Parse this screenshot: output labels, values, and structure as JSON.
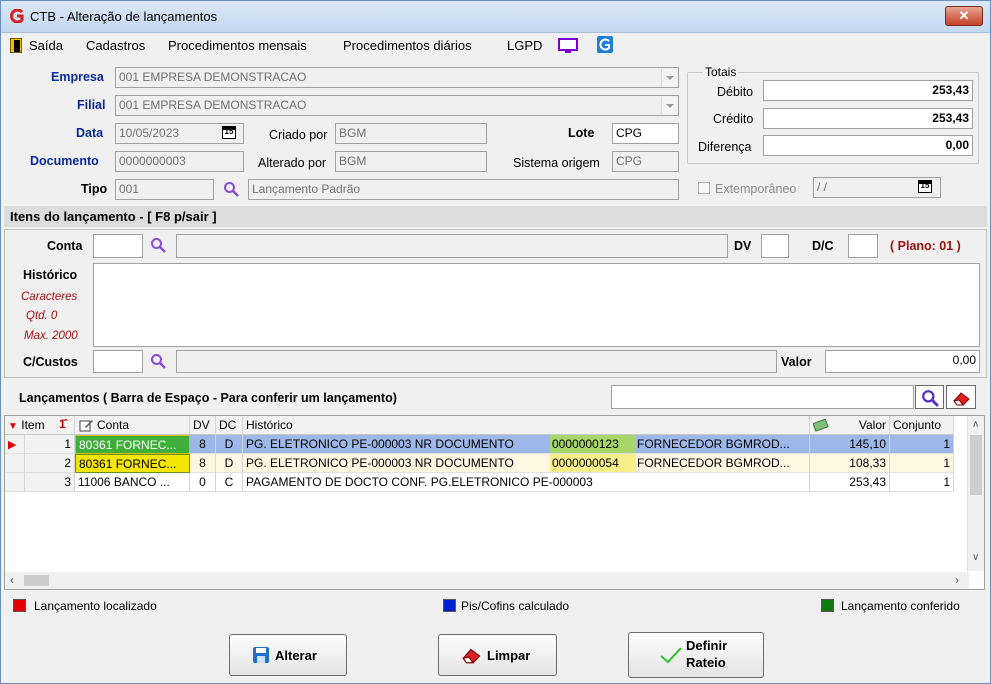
{
  "window": {
    "title": "CTB - Alteração de lançamentos",
    "close_glyph": "✕"
  },
  "menu": {
    "items": [
      "Saída",
      "Cadastros",
      "Procedimentos mensais",
      "Procedimentos diários",
      "LGPD"
    ]
  },
  "header": {
    "empresa_label": "Empresa",
    "empresa_value": "001 EMPRESA DEMONSTRACAO",
    "filial_label": "Filial",
    "filial_value": "001 EMPRESA DEMONSTRACAO",
    "data_label": "Data",
    "data_value": "10/05/2023",
    "criado_label": "Criado por",
    "criado_value": "BGM",
    "lote_label": "Lote",
    "lote_value": "CPG",
    "documento_label": "Documento",
    "documento_value": "0000000003",
    "alterado_label": "Alterado por",
    "alterado_value": "BGM",
    "sistema_label": "Sistema origem",
    "sistema_value": "CPG",
    "tipo_label": "Tipo",
    "tipo_value": "001",
    "tipo_desc": "Lançamento Padrão",
    "extemporaneo_label": "Extemporâneo",
    "extemporaneo_value": " / /"
  },
  "totais": {
    "title": "Totais",
    "debito_label": "Débito",
    "debito_value": "253,43",
    "credito_label": "Crédito",
    "credito_value": "253,43",
    "diferenca_label": "Diferença",
    "diferenca_value": "0,00"
  },
  "itens": {
    "title": "Itens do lançamento - [ F8 p/sair ]",
    "conta_label": "Conta",
    "dv_label": "DV",
    "dc_label": "D/C",
    "plano": "( Plano: 01 )",
    "historico_label": "Histórico",
    "caracteres": "Caracteres",
    "qtd": "Qtd. 0",
    "max": "Max. 2000",
    "custos_label": "C/Custos",
    "valor_label": "Valor",
    "valor_value": "0,00"
  },
  "lancamentos": {
    "title": "Lançamentos ( Barra de Espaço - Para conferir um lançamento)",
    "columns": [
      "Item",
      "Conta",
      "DV",
      "DC",
      "Histórico",
      "Valor",
      "Conjunto"
    ],
    "rows": [
      {
        "item": "1",
        "conta": "80361 FORNEC...",
        "dv": "8",
        "dc": "D",
        "hist_a": "PG. ELETRONICO PE-000003  NR DOCUMENTO",
        "hist_doc": "0000000123",
        "hist_b": "FORNECEDOR BGMROD...",
        "valor": "145,10",
        "conjunto": "1"
      },
      {
        "item": "2",
        "conta": "80361 FORNEC...",
        "dv": "8",
        "dc": "D",
        "hist_a": "PG. ELETRONICO PE-000003  NR DOCUMENTO",
        "hist_doc": "0000000054",
        "hist_b": "FORNECEDOR BGMROD...",
        "valor": "108,33",
        "conjunto": "1"
      },
      {
        "item": "3",
        "conta": "11006 BANCO ...",
        "dv": "0",
        "dc": "C",
        "hist_a": "PAGAMENTO DE DOCTO CONF. PG.ELETRONICO PE-000003",
        "hist_doc": "",
        "hist_b": "",
        "valor": "253,43",
        "conjunto": "1"
      }
    ]
  },
  "legend": {
    "localizado": "Lançamento localizado",
    "piscofins": "Pis/Cofins calculado",
    "conferido": "Lançamento conferido"
  },
  "buttons": {
    "alterar": "Alterar",
    "limpar": "Limpar",
    "definir_1": "Definir",
    "definir_2": "Rateio"
  },
  "colors": {
    "selected_row": "#9db7e8",
    "highlight": "#f7f08a",
    "conta_green": "#a7d66a",
    "red": "#e00000",
    "blue": "#0020d0",
    "green": "#107a10"
  }
}
